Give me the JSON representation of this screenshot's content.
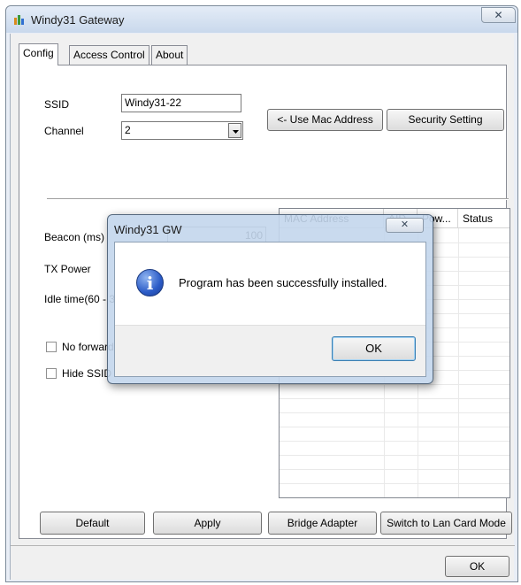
{
  "window": {
    "title": "Windy31 Gateway",
    "close_glyph": "✕"
  },
  "tabs": [
    {
      "label": "Config",
      "selected": true
    },
    {
      "label": "Access Control",
      "selected": false
    },
    {
      "label": "About",
      "selected": false
    }
  ],
  "config": {
    "ssid_label": "SSID",
    "ssid_value": "Windy31-22",
    "channel_label": "Channel",
    "channel_value": "2",
    "use_mac_button": "<- Use Mac Address",
    "security_button": "Security Setting",
    "beacon_label": "Beacon (ms)",
    "beacon_value": "100",
    "tx_power_label": "TX Power",
    "idle_time_label": "Idle time(60 - 3",
    "no_forward_label": "No forward",
    "hide_ssid_label": "Hide SSID"
  },
  "station_list": {
    "columns": [
      "MAC Address",
      "AID",
      "Pow...",
      "Status"
    ],
    "rows": []
  },
  "bottom_buttons": {
    "default": "Default",
    "apply": "Apply",
    "bridge": "Bridge Adapter",
    "switch_mode": "Switch to Lan Card Mode",
    "ok": "OK"
  },
  "dialog": {
    "title": "Windy31 GW",
    "close_glyph": "✕",
    "icon": "info-icon",
    "icon_glyph": "i",
    "message": "Program has been successfully installed.",
    "ok": "OK"
  },
  "colors": {
    "titlebar": "#c9d8ec",
    "dialog_frame": "#c3d6ec",
    "info_icon": "#2b5bc7"
  }
}
